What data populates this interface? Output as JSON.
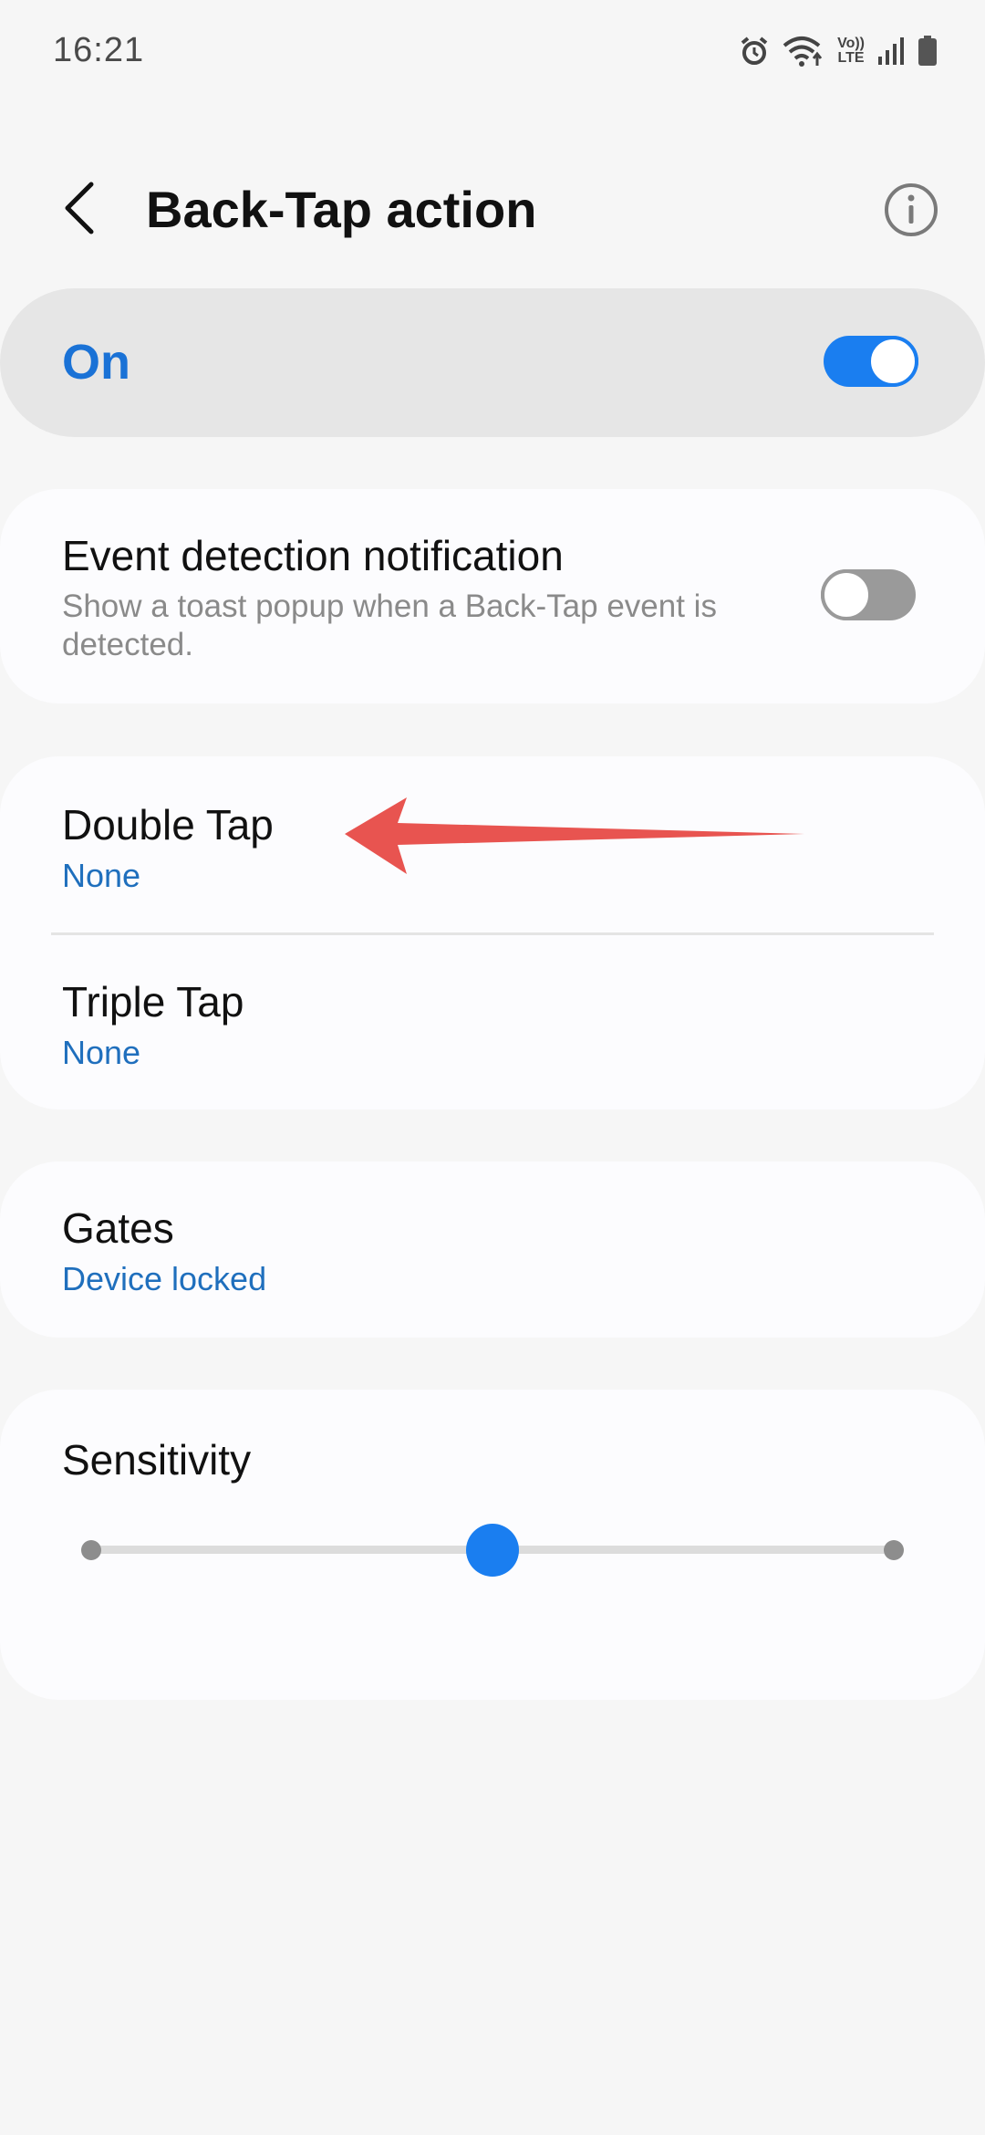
{
  "status_bar": {
    "time": "16:21",
    "network_label_top": "Vo))",
    "network_label_bottom": "LTE",
    "icons": [
      "alarm-icon",
      "wifi-icon",
      "volte-icon",
      "signal-icon",
      "battery-icon"
    ]
  },
  "header": {
    "title": "Back-Tap action",
    "back_icon": "chevron-left-icon",
    "info_icon": "info-icon"
  },
  "master": {
    "label": "On",
    "enabled": true
  },
  "event_detection": {
    "title": "Event detection notification",
    "subtitle": "Show a toast popup when a Back-Tap event is detected.",
    "enabled": false
  },
  "taps": [
    {
      "title": "Double Tap",
      "value": "None"
    },
    {
      "title": "Triple Tap",
      "value": "None"
    }
  ],
  "gates": {
    "title": "Gates",
    "value": "Device locked"
  },
  "sensitivity": {
    "title": "Sensitivity",
    "steps": 3,
    "selected_step": 2,
    "level_fraction": 0.5
  },
  "colors": {
    "accent": "#1a7ef0",
    "value_text": "#1f6fbd",
    "background": "#f6f6f6",
    "card": "#fcfcfe",
    "annotation_arrow": "#e85450"
  }
}
